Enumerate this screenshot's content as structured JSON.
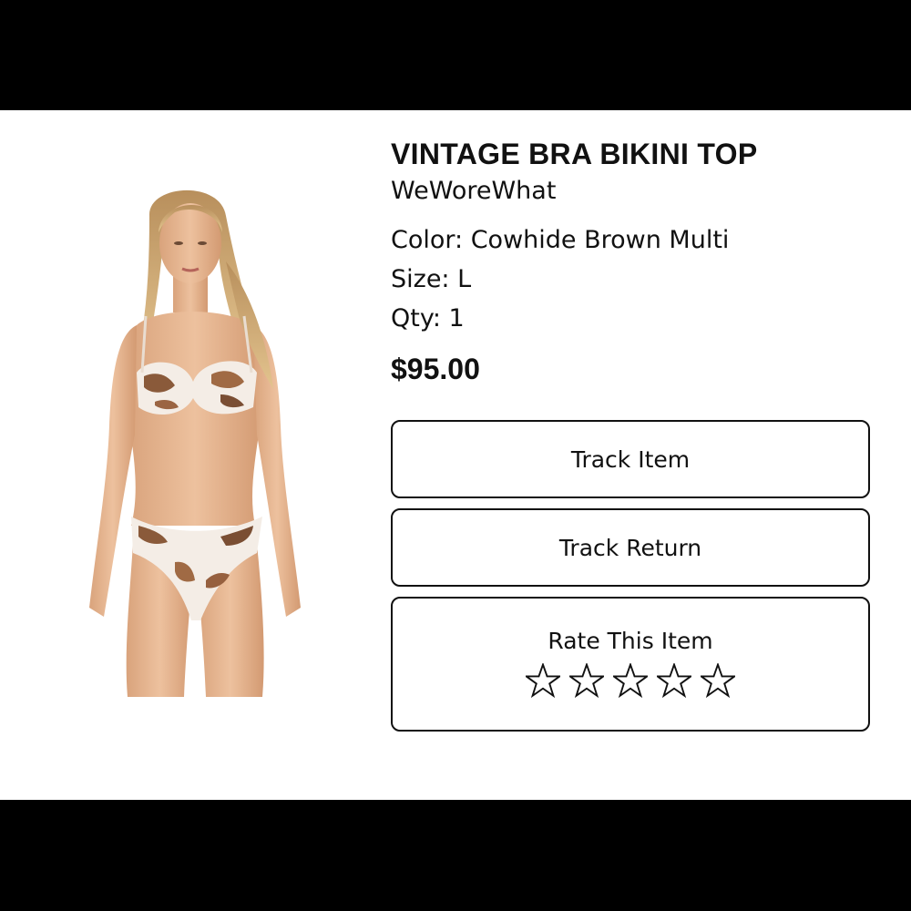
{
  "product": {
    "title": "VINTAGE BRA BIKINI TOP",
    "brand": "WeWoreWhat",
    "color_line": "Color: Cowhide Brown Multi",
    "size_line": "Size: L",
    "qty_line": "Qty: 1",
    "price": "$95.00"
  },
  "actions": {
    "track_item": "Track Item",
    "track_return": "Track Return",
    "rate_label": "Rate This Item"
  },
  "rating": {
    "max": 5,
    "value": 0
  },
  "icons": {
    "star": "star-outline-icon"
  },
  "colors": {
    "border": "#111111",
    "background": "#ffffff",
    "letterbox": "#000000"
  }
}
